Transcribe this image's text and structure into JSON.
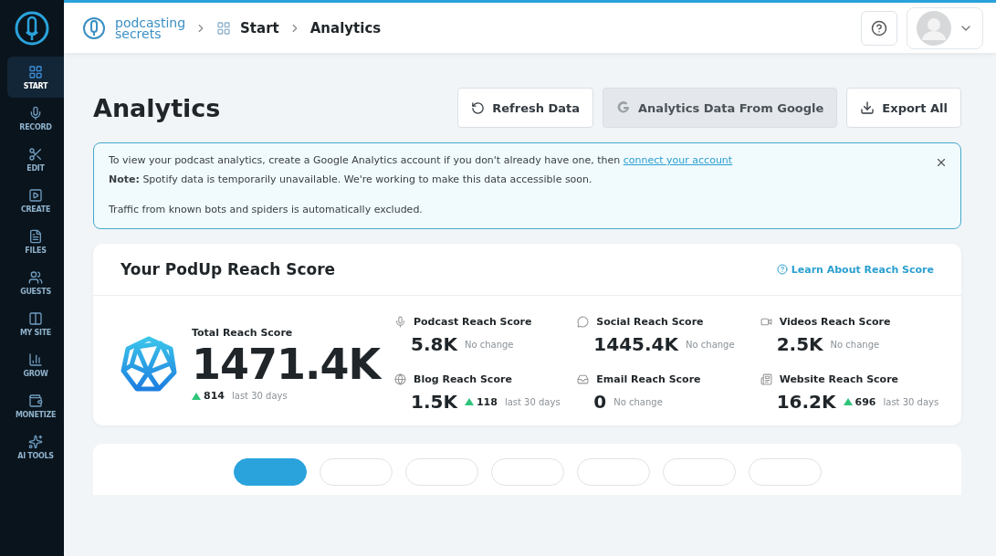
{
  "sidebar": {
    "items": [
      {
        "label": "START",
        "selected": true
      },
      {
        "label": "RECORD",
        "selected": false
      },
      {
        "label": "EDIT",
        "selected": false
      },
      {
        "label": "CREATE",
        "selected": false
      },
      {
        "label": "FILES",
        "selected": false
      },
      {
        "label": "GUESTS",
        "selected": false
      },
      {
        "label": "MY SITE",
        "selected": false
      },
      {
        "label": "GROW",
        "selected": false
      },
      {
        "label": "MONETIZE",
        "selected": false
      },
      {
        "label": "AI TOOLS",
        "selected": false
      }
    ]
  },
  "header": {
    "logo": [
      "podcasting",
      "secrets"
    ],
    "breadcrumbs": [
      "Start",
      "Analytics"
    ]
  },
  "page": {
    "title": "Analytics",
    "buttons": [
      {
        "label": "Refresh Data",
        "disabled": false
      },
      {
        "label": "Analytics Data From Google",
        "disabled": true
      },
      {
        "label": "Export All",
        "disabled": false
      }
    ]
  },
  "notice": {
    "line1": "To view your podcast analytics, create a Google Analytics account if you don't already have one, then",
    "link": "connect your account",
    "line2": "**Note:** Spotify data is temporarily unavailable. We're working to make this data accessible soon.",
    "line3": "Traffic from known bots and spiders is automatically excluded."
  },
  "reach": {
    "title": "Your PodUp Reach Score",
    "learn": "Learn About Reach Score",
    "total": {
      "label": "Total Reach Score",
      "value": "1471.4K",
      "kind": "up",
      "delta": "814",
      "note": "last 30 days"
    },
    "metrics": [
      {
        "label": "Podcast Reach Score",
        "value": "5.8K",
        "kind": "flat",
        "note": "No change"
      },
      {
        "label": "Social Reach Score",
        "value": "1445.4K",
        "kind": "flat",
        "note": "No change"
      },
      {
        "label": "Videos Reach Score",
        "value": "2.5K",
        "kind": "flat",
        "note": "No change"
      },
      {
        "label": "Blog Reach Score",
        "value": "1.5K",
        "kind": "up",
        "delta": "118",
        "note": "last 30 days"
      },
      {
        "label": "Email Reach Score",
        "value": "0",
        "kind": "flat",
        "note": "No change"
      },
      {
        "label": "Website Reach Score",
        "value": "16.2K",
        "kind": "up",
        "delta": "696",
        "note": "last 30 days"
      }
    ]
  },
  "tabs": [
    {
      "selected": true
    },
    {
      "selected": false
    },
    {
      "selected": false
    },
    {
      "selected": false
    },
    {
      "selected": false
    },
    {
      "selected": false
    },
    {
      "selected": false
    }
  ]
}
